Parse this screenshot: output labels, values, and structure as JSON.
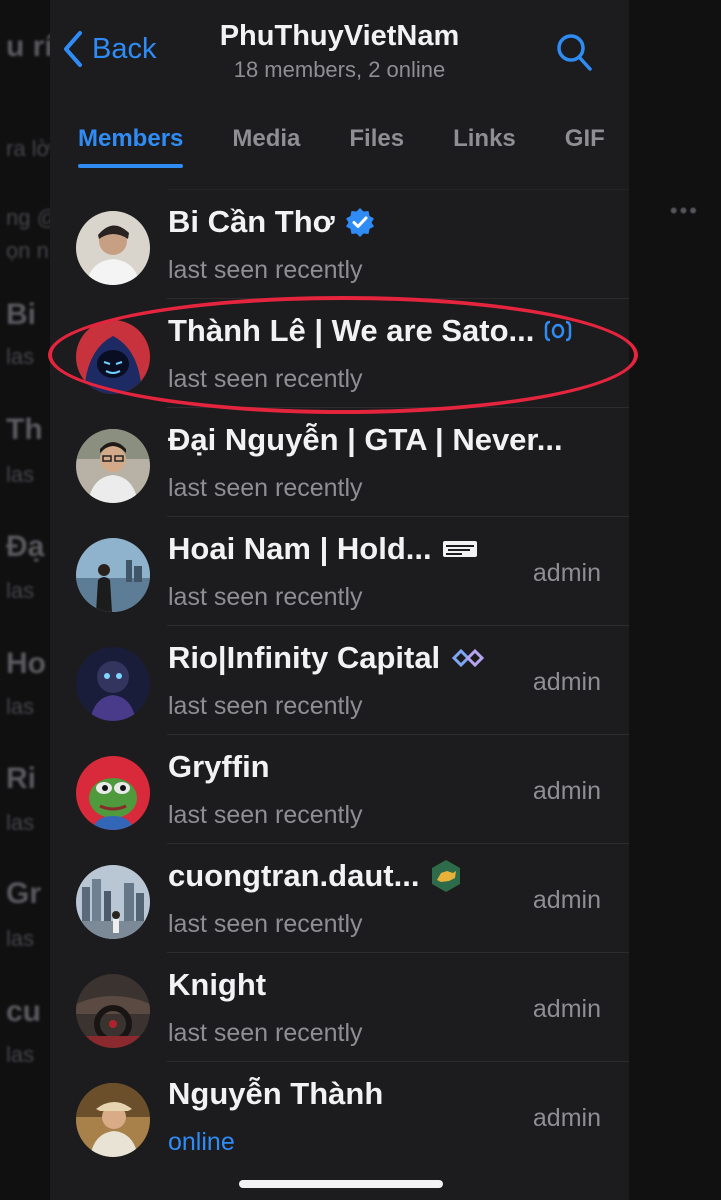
{
  "background": {
    "fragments": [
      "u ríu",
      "ra lời",
      "ng @",
      "ọn n",
      "Bi",
      "las",
      "Th",
      "las",
      "Đạ",
      "las",
      "Ho",
      "las",
      "Ri",
      "las",
      "Gr",
      "las",
      "cu",
      "las"
    ]
  },
  "nav": {
    "back_label": "Back",
    "title": "PhuThuyVietNam",
    "subtitle": "18 members, 2 online"
  },
  "tabs": [
    {
      "label": "Members",
      "active": true
    },
    {
      "label": "Media",
      "active": false
    },
    {
      "label": "Files",
      "active": false
    },
    {
      "label": "Links",
      "active": false
    },
    {
      "label": "GIF",
      "active": false
    }
  ],
  "members": [
    {
      "name": "Bi Cần Thơ",
      "status": "last seen recently",
      "role": "",
      "badge": "verified-icon",
      "avatar": "avatar-person-white-shirt"
    },
    {
      "name": "Thành Lê | We are Sato...",
      "status": "last seen recently",
      "role": "",
      "badge": "emoji-status-icon",
      "avatar": "avatar-hooded-figure"
    },
    {
      "name": "Đại Nguyễn | GTA | Never...",
      "status": "last seen recently",
      "role": "",
      "badge": "",
      "avatar": "avatar-person-glasses"
    },
    {
      "name": "Hoai Nam | Hold...",
      "status": "last seen recently",
      "role": "admin",
      "badge": "hold-sticker-icon",
      "avatar": "avatar-person-city"
    },
    {
      "name": "Rio|Infinity Capital",
      "status": "last seen recently",
      "role": "admin",
      "badge": "infinity-icon",
      "avatar": "avatar-robot-figure"
    },
    {
      "name": "Gryffin",
      "status": "last seen recently",
      "role": "admin",
      "badge": "",
      "avatar": "avatar-pepe-frog"
    },
    {
      "name": "cuongtran.daut...",
      "status": "last seen recently",
      "role": "admin",
      "badge": "bull-icon",
      "avatar": "avatar-city-skyline"
    },
    {
      "name": "Knight",
      "status": "last seen recently",
      "role": "admin",
      "badge": "",
      "avatar": "avatar-car-interior"
    },
    {
      "name": "Nguyễn Thành",
      "status": "online",
      "role": "admin",
      "badge": "",
      "avatar": "avatar-person-hat"
    }
  ],
  "colors": {
    "accent": "#2f8cf5",
    "highlight": "#e5243e",
    "panel": "#1c1c1e",
    "text_primary": "#f2f2f5",
    "text_secondary": "#8e8e93"
  }
}
